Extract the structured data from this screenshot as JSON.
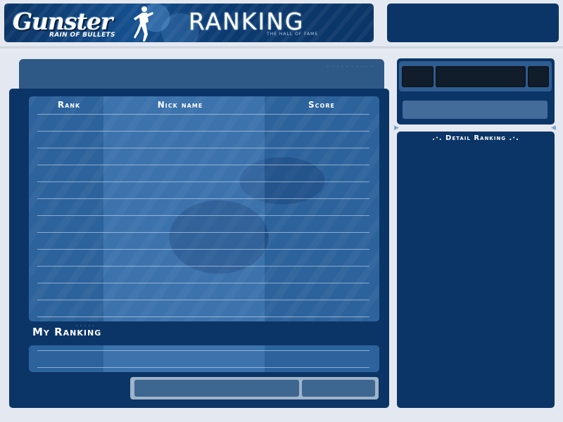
{
  "header": {
    "logo": {
      "main": "Gunster",
      "sub": "RAIN OF BULLETS"
    },
    "title": "RANKING",
    "subtitle": "THE HALL OF FAME"
  },
  "ranking_table": {
    "columns": [
      "Rank",
      "Nick name",
      "Score"
    ],
    "row_count": 12
  },
  "my_ranking": {
    "title": "My Ranking"
  },
  "detail": {
    "title": ".·. Detail Ranking .·."
  },
  "colors": {
    "panel": "#0b3566",
    "table": "#2d639c",
    "background": "#e4e9f1",
    "button": "#3d6690"
  },
  "icons": [
    "character-figure-icon",
    "arrow-left-icon",
    "arrow-right-icon"
  ]
}
